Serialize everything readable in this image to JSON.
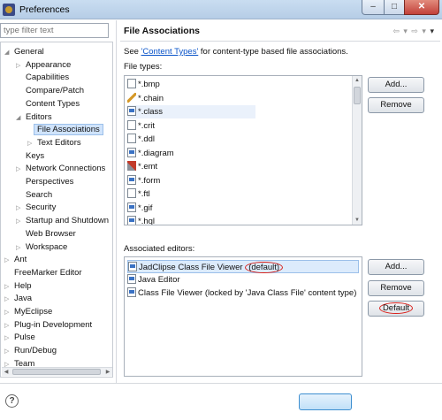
{
  "window": {
    "title": "Preferences",
    "controls": {
      "minimize": "–",
      "maximize": "□",
      "close": "✕"
    }
  },
  "filter": {
    "placeholder": "type filter text"
  },
  "tree": {
    "items": [
      {
        "label": "General",
        "level": 0,
        "expanded": true
      },
      {
        "label": "Appearance",
        "level": 1,
        "expander": true
      },
      {
        "label": "Capabilities",
        "level": 1
      },
      {
        "label": "Compare/Patch",
        "level": 1
      },
      {
        "label": "Content Types",
        "level": 1
      },
      {
        "label": "Editors",
        "level": 1,
        "expanded": true
      },
      {
        "label": "File Associations",
        "level": 2,
        "selected": true
      },
      {
        "label": "Text Editors",
        "level": 2,
        "expander": true
      },
      {
        "label": "Keys",
        "level": 1
      },
      {
        "label": "Network Connections",
        "level": 1,
        "expander": true
      },
      {
        "label": "Perspectives",
        "level": 1
      },
      {
        "label": "Search",
        "level": 1
      },
      {
        "label": "Security",
        "level": 1,
        "expander": true
      },
      {
        "label": "Startup and Shutdown",
        "level": 1,
        "expander": true
      },
      {
        "label": "Web Browser",
        "level": 1
      },
      {
        "label": "Workspace",
        "level": 1,
        "expander": true
      },
      {
        "label": "Ant",
        "level": 0,
        "expander": true
      },
      {
        "label": "FreeMarker Editor",
        "level": 0
      },
      {
        "label": "Help",
        "level": 0,
        "expander": true
      },
      {
        "label": "Java",
        "level": 0,
        "expander": true
      },
      {
        "label": "MyEclipse",
        "level": 0,
        "expander": true
      },
      {
        "label": "Plug-in Development",
        "level": 0,
        "expander": true
      },
      {
        "label": "Pulse",
        "level": 0,
        "expander": true
      },
      {
        "label": "Run/Debug",
        "level": 0,
        "expander": true
      },
      {
        "label": "Team",
        "level": 0,
        "expander": true
      }
    ]
  },
  "page": {
    "title": "File Associations",
    "nav_icons": [
      "back-icon",
      "forward-icon",
      "view-menu-icon"
    ],
    "see_prefix": "See ",
    "content_types_link": "'Content Types'",
    "see_suffix": " for content-type based file associations.",
    "file_types_label": "File types:",
    "file_types": [
      {
        "name": "*.bmp",
        "icon": "file-icon"
      },
      {
        "name": "*.chain",
        "icon": "pen-icon"
      },
      {
        "name": "*.class",
        "icon": "class-file-icon",
        "highlighted": true
      },
      {
        "name": "*.crit",
        "icon": "file-icon"
      },
      {
        "name": "*.ddl",
        "icon": "ddl-icon"
      },
      {
        "name": "*.diagram",
        "icon": "diagram-icon"
      },
      {
        "name": "*.emt",
        "icon": "tools-icon"
      },
      {
        "name": "*.form",
        "icon": "form-icon"
      },
      {
        "name": "*.ftl",
        "icon": "file-icon"
      },
      {
        "name": "*.gif",
        "icon": "image-icon"
      },
      {
        "name": "*.hql",
        "icon": "hql-icon"
      }
    ],
    "add_button": "Add...",
    "remove_button": "Remove",
    "editors_label": "Associated editors:",
    "editors": [
      {
        "name": "JadClipse Class File Viewer",
        "suffix": "(default)",
        "selected": true
      },
      {
        "name": "Java Editor",
        "suffix": ""
      },
      {
        "name": "Class File Viewer (locked by 'Java Class File' content type)",
        "suffix": ""
      }
    ],
    "editor_add_button": "Add...",
    "editor_remove_button": "Remove",
    "default_button": "Default"
  },
  "footer": {
    "help": "?"
  },
  "accent_colors": {
    "link": "#0a54c9",
    "annotation": "#d8201a",
    "selection": "#dcebfc"
  }
}
